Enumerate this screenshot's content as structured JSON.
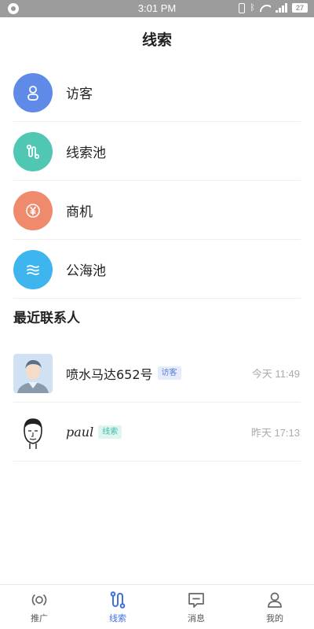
{
  "status_bar": {
    "time": "3:01 PM",
    "battery": "27"
  },
  "header": {
    "title": "线索"
  },
  "menu": [
    {
      "label": "访客",
      "icon": "visitor-icon",
      "color": "#5f8ae8"
    },
    {
      "label": "线索池",
      "icon": "lead-pool-icon",
      "color": "#4fc7b3"
    },
    {
      "label": "商机",
      "icon": "yen-icon",
      "color": "#ef8a6c"
    },
    {
      "label": "公海池",
      "icon": "sea-pool-icon",
      "color": "#3fb5ef"
    }
  ],
  "recent": {
    "title": "最近联系人",
    "contacts": [
      {
        "name": "喷水马达652号",
        "tag": "访客",
        "time": "今天 11:49"
      },
      {
        "name": "paul",
        "tag": "线索",
        "time": "昨天 17:13"
      }
    ]
  },
  "nav": {
    "active": "线索",
    "items": [
      {
        "label": "推广",
        "icon": "promotion-icon"
      },
      {
        "label": "线索",
        "icon": "leads-icon"
      },
      {
        "label": "消息",
        "icon": "message-icon"
      },
      {
        "label": "我的",
        "icon": "profile-icon"
      }
    ]
  }
}
